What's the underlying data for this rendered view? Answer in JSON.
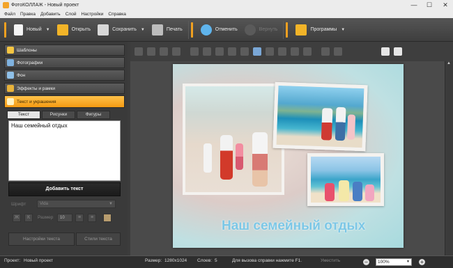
{
  "window": {
    "title": "ФотоКОЛЛАЖ - Новый проект",
    "controls": [
      "—",
      "☐",
      "✕"
    ]
  },
  "menu": [
    "Файл",
    "Правка",
    "Добавить",
    "Слой",
    "Настройки",
    "Справка"
  ],
  "toolbar": {
    "new": "Новый",
    "open": "Открыть",
    "save": "Сохранить",
    "print": "Печать",
    "undo": "Отменить",
    "redo": "Вернуть",
    "programs": "Программы"
  },
  "sidebar": {
    "items": [
      {
        "label": "Шаблоны",
        "icon": "star-icon"
      },
      {
        "label": "Фотографии",
        "icon": "photo-icon"
      },
      {
        "label": "Фон",
        "icon": "background-icon"
      },
      {
        "label": "Эффекты и рамки",
        "icon": "effects-icon"
      },
      {
        "label": "Текст и украшения",
        "icon": "text-icon"
      }
    ],
    "tabs": [
      "Текст",
      "Рисунки",
      "Фигуры"
    ],
    "text_value": "Наш семейный отдых",
    "add_text": "Добавить текст",
    "font_label": "Шрифт",
    "font_value": "Vida",
    "size_label": "Размер",
    "size_value": "10",
    "text_settings": "Настройки текста",
    "text_styles": "Стили текста"
  },
  "collage": {
    "caption": "Наш семейный отдых"
  },
  "status": {
    "project_label": "Проект:",
    "project_value": "Новый проект",
    "size_label": "Размер:",
    "size_value": "1280x1024",
    "layers_label": "Слоев:",
    "layers_value": "5",
    "help": "Для вызова справки нажмите F1.",
    "fit": "Уместить",
    "zoom": "100%"
  },
  "colors": {
    "accent": "#f59a12",
    "caption": "#7cc7e6"
  }
}
